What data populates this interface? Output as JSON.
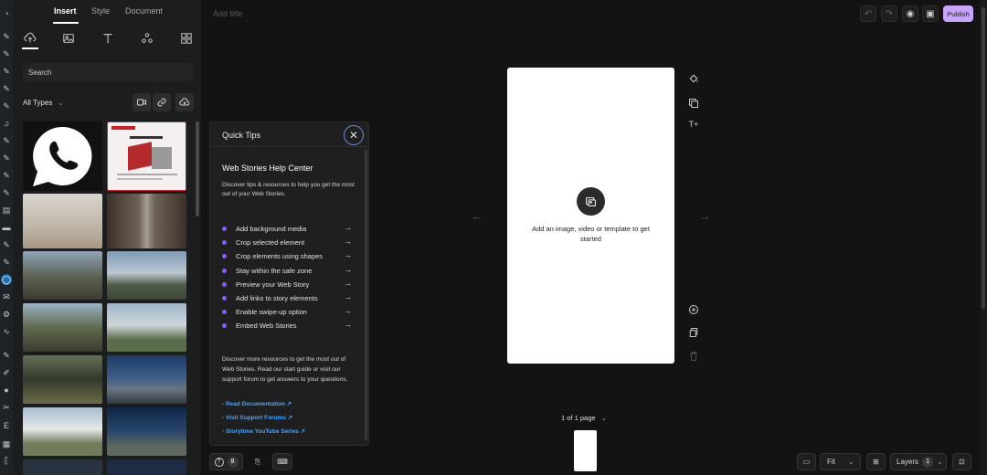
{
  "wp_sidebar": {
    "icons": [
      "dashboard-icon",
      "pin-icon",
      "pin-icon",
      "pin-icon",
      "pin-icon",
      "pin-icon",
      "media-icon",
      "pin-icon",
      "pin-icon",
      "pin-icon",
      "pin-icon",
      "pages-icon",
      "comments-icon",
      "pin-icon",
      "pin-icon",
      "web-stories-icon",
      "mail-icon",
      "settings-icon",
      "analytics-icon",
      "pin-icon",
      "appearance-icon",
      "users-icon",
      "tools-icon",
      "elementor-icon",
      "grid-icon",
      "collapse-icon"
    ]
  },
  "library": {
    "tabs": [
      "Insert",
      "Style",
      "Document"
    ],
    "active_tab": "Insert",
    "subtabs": [
      "upload-icon",
      "image-icon",
      "text-icon",
      "shapes-icon",
      "templates-icon"
    ],
    "search": {
      "placeholder": "Search",
      "value": "Search"
    },
    "filter": {
      "label": "All Types"
    },
    "media_buttons": [
      "video-icon",
      "link-icon",
      "cloud-upload-icon"
    ],
    "thumbnails": [
      {
        "name": "whatsapp-logo"
      },
      {
        "name": "presentation-slide"
      },
      {
        "name": "interior-room"
      },
      {
        "name": "interior-hall"
      },
      {
        "name": "house-forest"
      },
      {
        "name": "house-white"
      },
      {
        "name": "house-wood"
      },
      {
        "name": "house-pool"
      },
      {
        "name": "house-dark"
      },
      {
        "name": "house-night"
      },
      {
        "name": "house-modern"
      },
      {
        "name": "house-evening"
      }
    ]
  },
  "quick_tips": {
    "header": "Quick Tips",
    "heading": "Web Stories Help Center",
    "intro": "Discover tips & resources to help you get the most out of your Web Stories.",
    "items": [
      "Add background media",
      "Crop selected element",
      "Crop elements using shapes",
      "Stay within the safe zone",
      "Preview your Web Story",
      "Add links to story elements",
      "Enable swipe-up option",
      "Embed Web Stories"
    ],
    "more": "Discover more resources to get the most out of Web Stories. Read our start guide or visit our support forum to get answers to your questions.",
    "links": [
      "- Read Documentation",
      "- Visit Support Forums",
      "- Storytime YouTube Series"
    ]
  },
  "bottom_left": {
    "help_count": "8"
  },
  "editor": {
    "title_placeholder": "Add title",
    "publish_label": "Publish",
    "page_empty_text": "Add an image, video or template to get started",
    "page_count": "1 of 1 page",
    "zoom": "Fit",
    "layers_label": "Layers",
    "layers_count": "1"
  },
  "colors": {
    "accent": "#c8a6ff",
    "tip_dot": "#8b5cf6",
    "link": "#4aa3ff",
    "wp_active": "#2271b1"
  }
}
